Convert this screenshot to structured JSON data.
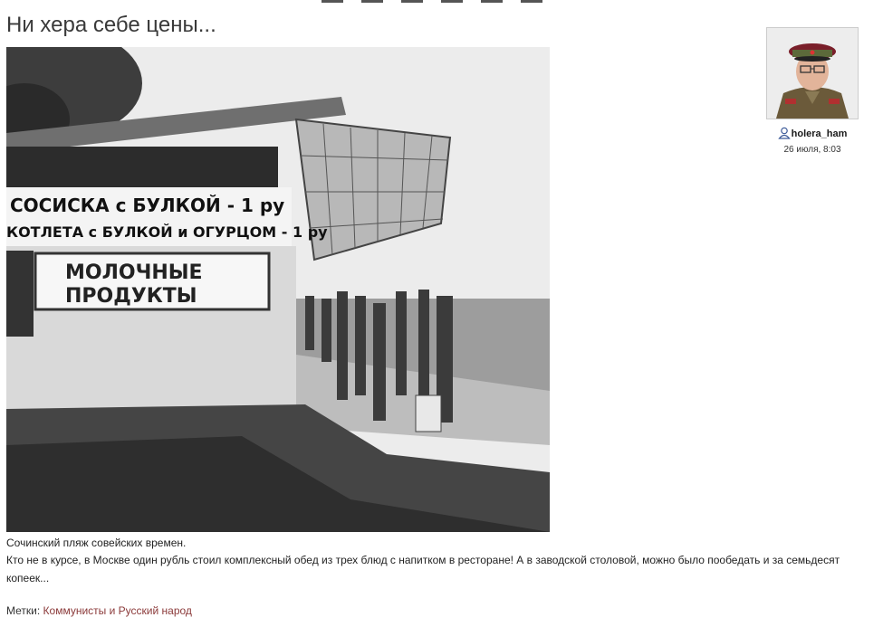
{
  "post": {
    "title": "Ни хера себе цены...",
    "caption": "Сочинский пляж совейских времен.",
    "body": "Кто не в курсе, в Москве один рубль стоил комплексный обед из трех блюд с напитком в ресторане! А в заводской столовой, можно было пообедать и за семьдесят копеек...",
    "tags_label": "Метки:",
    "tag": "Коммунисты и Русский народ"
  },
  "photo_signs": {
    "line1": "СОСИСКА с БУЛКОЙ - 1 ру",
    "line2": "КОТЛЕТА с БУЛКОЙ и ОГУРЦОМ - 1 ру",
    "board1": "МОЛОЧНЫЕ",
    "board2": "ПРОДУКТЫ"
  },
  "author": {
    "name": "holera_ham",
    "date": "26 июля, 8:03",
    "icon": "user-icon"
  },
  "colors": {
    "tag_link": "#8b3a3a",
    "title": "#3a3a3a"
  }
}
